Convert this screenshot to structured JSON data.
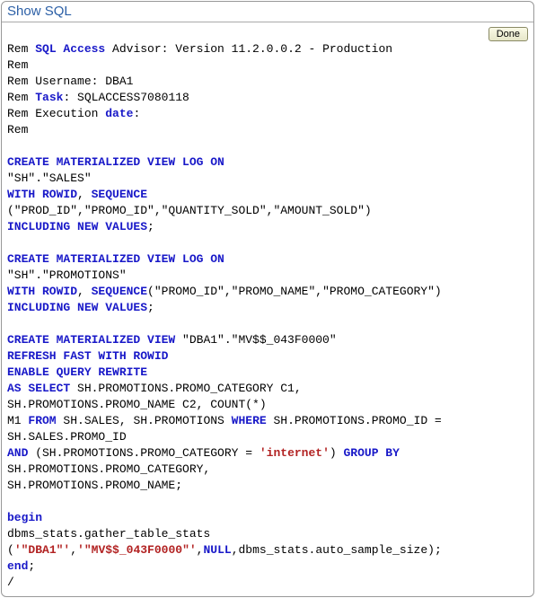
{
  "header": {
    "title": "Show SQL",
    "done_label": "Done"
  },
  "rem": {
    "line1_rem": "Rem",
    "line1_sql_access": "SQL Access",
    "line1_rest": " Advisor: Version 11.2.0.0.2 - Production",
    "line2": "Rem",
    "line3": "Rem Username: DBA1",
    "line4_prefix": "Rem ",
    "line4_task": "Task",
    "line4_rest": ": SQLACCESS7080118",
    "line5_prefix": "Rem Execution ",
    "line5_date": "date",
    "line5_colon": ":",
    "line6": "Rem"
  },
  "blk1": {
    "l1": "CREATE MATERIALIZED VIEW LOG ON",
    "l2": "\"SH\".\"SALES\"",
    "l3a": "WITH ROWID",
    "l3comma": ", ",
    "l3b": "SEQUENCE",
    "l4": "(\"PROD_ID\",\"PROMO_ID\",\"QUANTITY_SOLD\",\"AMOUNT_SOLD\")",
    "l5a": "INCLUDING NEW VALUES",
    "l5b": ";"
  },
  "blk2": {
    "l1": "CREATE MATERIALIZED VIEW LOG ON",
    "l2": "\"SH\".\"PROMOTIONS\"",
    "l3a": "WITH ROWID",
    "l3comma": ", ",
    "l3b": "SEQUENCE",
    "l3c": "(\"PROMO_ID\",\"PROMO_NAME\",\"PROMO_CATEGORY\")",
    "l4a": "INCLUDING NEW VALUES",
    "l4b": ";"
  },
  "blk3": {
    "l1a": "CREATE MATERIALIZED VIEW",
    "l1b": " \"DBA1\".\"MV$$_043F0000\"",
    "l2": "REFRESH FAST WITH ROWID",
    "l3": "ENABLE QUERY REWRITE",
    "l4a": "AS SELECT",
    "l4b": " SH.PROMOTIONS.PROMO_CATEGORY C1,",
    "l5": "SH.PROMOTIONS.PROMO_NAME C2, COUNT(*)",
    "l6a": "M1 ",
    "l6from": "FROM",
    "l6b": " SH.SALES, SH.PROMOTIONS ",
    "l6where": "WHERE",
    "l6c": " SH.PROMOTIONS.PROMO_ID =",
    "l7": "SH.SALES.PROMO_ID",
    "l8and": "AND",
    "l8a": " (SH.PROMOTIONS.PROMO_CATEGORY = ",
    "l8str": "'internet'",
    "l8b": ") ",
    "l8group": "GROUP BY",
    "l9": "SH.PROMOTIONS.PROMO_CATEGORY,",
    "l10": "SH.PROMOTIONS.PROMO_NAME;"
  },
  "blk4": {
    "begin": "begin",
    "l2": "dbms_stats.gather_table_stats",
    "l3a": "(",
    "l3s1": "'\"DBA1\"'",
    "l3c1": ",",
    "l3s2": "'\"MV$$_043F0000\"'",
    "l3c2": ",",
    "l3null": "NULL",
    "l3rest": ",dbms_stats.auto_sample_size);",
    "end": "end",
    "endsemi": ";",
    "slash": "/"
  }
}
